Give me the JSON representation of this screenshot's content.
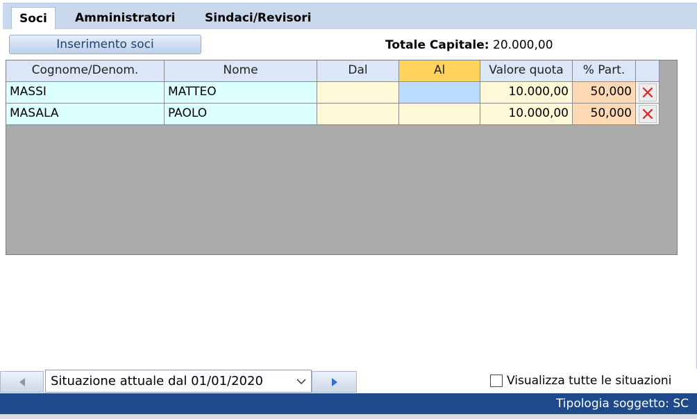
{
  "tabs": [
    {
      "label": "Soci",
      "active": true
    },
    {
      "label": "Amministratori",
      "active": false
    },
    {
      "label": "Sindaci/Revisori",
      "active": false
    }
  ],
  "toolbar": {
    "insert_label": "Inserimento soci",
    "totale_label": "Totale Capitale:",
    "totale_value": "20.000,00"
  },
  "grid": {
    "columns": [
      "Cognome/Denom.",
      "Nome",
      "Dal",
      "Al",
      "Valore quota",
      "% Part."
    ],
    "rows": [
      {
        "cognome": "MASSI",
        "nome": "MATTEO",
        "dal": "",
        "al": "",
        "valore": "10.000,00",
        "part": "50,000"
      },
      {
        "cognome": "MASALA",
        "nome": "PAOLO",
        "dal": "",
        "al": "",
        "valore": "10.000,00",
        "part": "50,000"
      }
    ]
  },
  "nav": {
    "situazione": "Situazione attuale dal 01/01/2020",
    "visualizza_label": "Visualizza tutte le situazioni"
  },
  "status": {
    "text": "Tipologia soggetto: SC"
  },
  "colors": {
    "accent": "#1e4a8c",
    "sort_header": "#ffd35c",
    "delete_red": "#e02020"
  }
}
